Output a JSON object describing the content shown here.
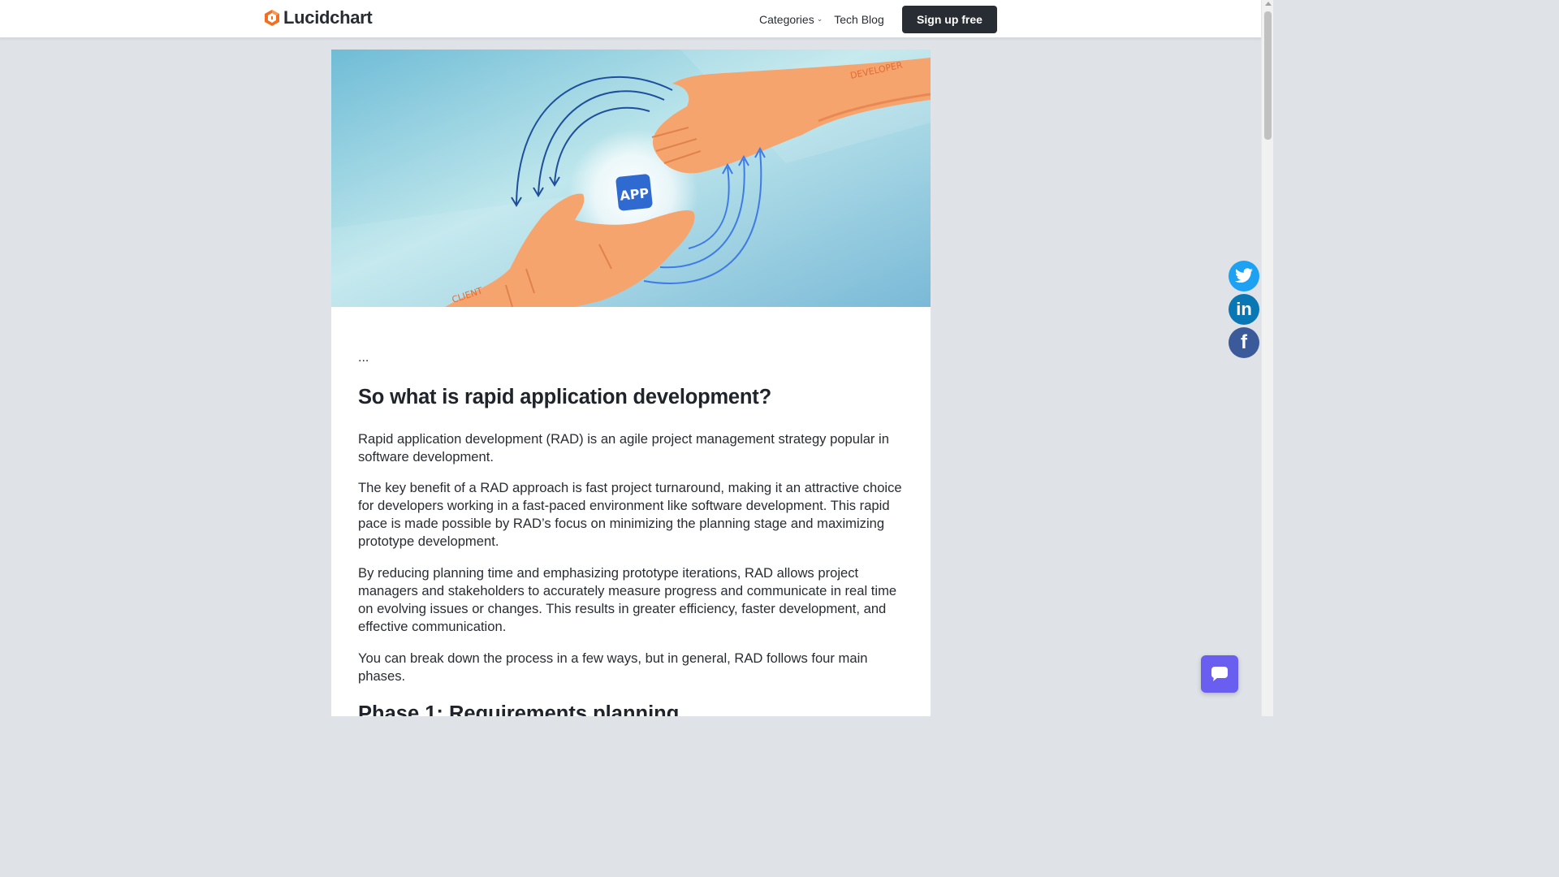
{
  "nav": {
    "brand": "Lucidchart",
    "categories_label": "Categories",
    "tech_blog_label": "Tech Blog",
    "signup_label": "Sign up free"
  },
  "hero": {
    "badge_text": "APP",
    "client_label": "CLIENT",
    "developer_label": "DEVELOPER"
  },
  "article": {
    "ellipsis": "...",
    "heading": "So what is rapid application development?",
    "paragraphs": [
      "Rapid application development (RAD) is an agile project management strategy popular in software development.",
      "The key benefit of a RAD approach is fast project turnaround, making it an attractive choice for developers working in a fast-paced environment like software development. This rapid pace is made possible by RAD’s focus on minimizing the planning stage and maximizing prototype development.",
      "By reducing planning time and emphasizing prototype iterations, RAD allows project managers and stakeholders to accurately measure progress and communicate in real time on evolving issues or changes. This results in greater efficiency, faster development, and effective communication.",
      "You can break down the process in a few ways, but in general, RAD follows four main phases."
    ],
    "next_heading": "Phase 1: Requirements planning"
  },
  "colors": {
    "accent_orange": "#f26e21",
    "button_dark": "#282c33",
    "twitter": "#1da1f2",
    "linkedin": "#0a77b5",
    "facebook": "#3b5a9a",
    "chat": "#6a5ef0"
  },
  "icons": {
    "logo": "lucidchart-logo-icon",
    "categories_chevron": "chevron-down-icon",
    "twitter": "twitter-icon",
    "linkedin": "linkedin-icon",
    "facebook": "facebook-icon",
    "chat": "chat-icon"
  }
}
